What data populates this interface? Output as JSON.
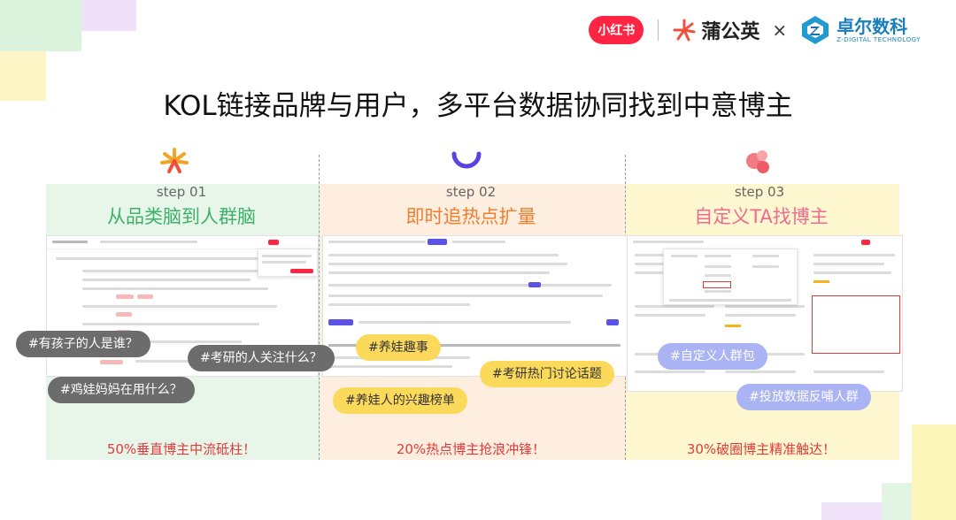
{
  "header": {
    "xhs_logo": "小红书",
    "pgy_logo": "蒲公英",
    "times": "×",
    "zr_logo_cn": "卓尔数科",
    "zr_logo_en": "Z-DIGITAL TECHNOLOGY",
    "title": "KOL链接品牌与用户，多平台数据协同找到中意博主"
  },
  "colors": {
    "green": "#3db06a",
    "orange": "#f07e2e",
    "pink": "#ef6a8e",
    "red": "#e23b3b",
    "brand_red": "#ff2442"
  },
  "steps": [
    {
      "step": "step 01",
      "title": "从品类脑到人群脑",
      "footer": "50%垂直博主中流砥柱！",
      "tags": [
        "#有孩子的人是谁？",
        "#考研的人关注什么？",
        "#鸡娃妈妈在用什么？"
      ]
    },
    {
      "step": "step 02",
      "title": "即时追热点扩量",
      "footer": "20%热点博主抢浪冲锋！",
      "tags": [
        "#养娃趣事",
        "#考研热门讨论话题",
        "#养娃人的兴趣榜单"
      ]
    },
    {
      "step": "step 03",
      "title": "自定义TA找博主",
      "footer": "30%破圈博主精准触达！",
      "tags": [
        "#自定义人群包",
        "#投放数据反哺人群"
      ]
    }
  ]
}
